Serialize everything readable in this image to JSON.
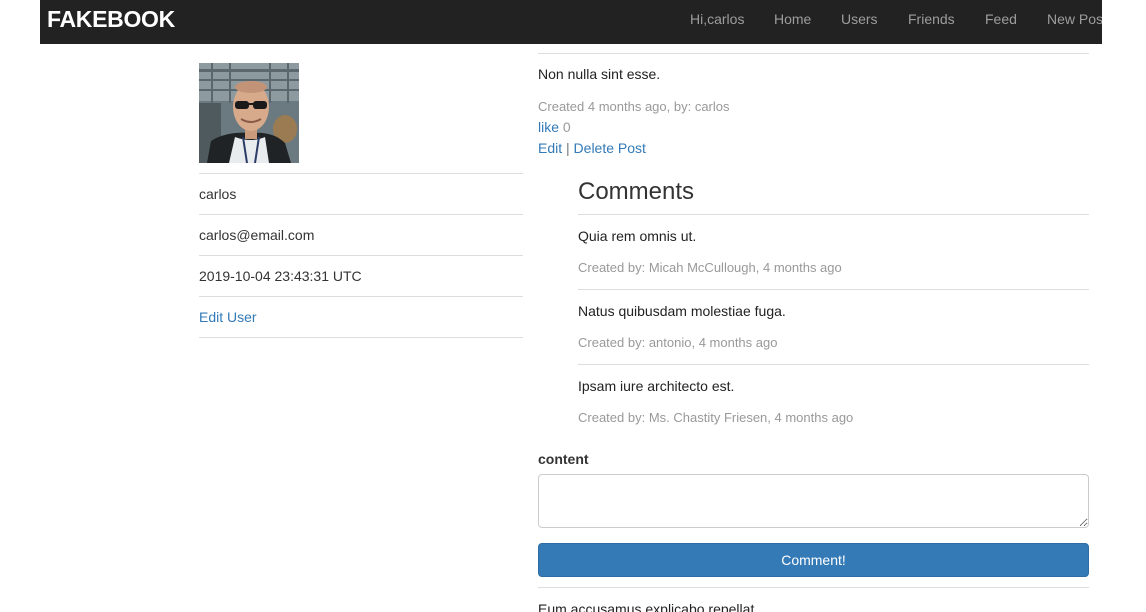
{
  "nav": {
    "brand": "FAKEBOOK",
    "greeting": "Hi,carlos",
    "links": [
      "Home",
      "Users",
      "Friends",
      "Feed",
      "New Pos"
    ]
  },
  "profile": {
    "name": "carlos",
    "email": "carlos@email.com",
    "created_at": "2019-10-04 23:43:31 UTC",
    "edit_label": "Edit User"
  },
  "post": {
    "content": "Non nulla sint esse.",
    "meta": "Created 4 months ago, by: carlos",
    "like_label": "like",
    "like_count": "0",
    "edit_label": "Edit",
    "separator": "|",
    "delete_label": "Delete Post"
  },
  "comments": {
    "title": "Comments",
    "items": [
      {
        "text": "Quia rem omnis ut.",
        "meta": "Created by: Micah McCullough, 4 months ago"
      },
      {
        "text": "Natus quibusdam molestiae fuga.",
        "meta": "Created by: antonio, 4 months ago"
      },
      {
        "text": "Ipsam iure architecto est.",
        "meta": "Created by: Ms. Chastity Friesen, 4 months ago"
      }
    ]
  },
  "comment_form": {
    "label": "content",
    "value": "",
    "submit_label": "Comment!"
  },
  "next_post": {
    "content": "Eum accusamus explicabo repellat."
  },
  "colors": {
    "navbar_bg": "#222222",
    "link": "#337ab7",
    "button": "#337ab7",
    "muted": "#999999"
  }
}
